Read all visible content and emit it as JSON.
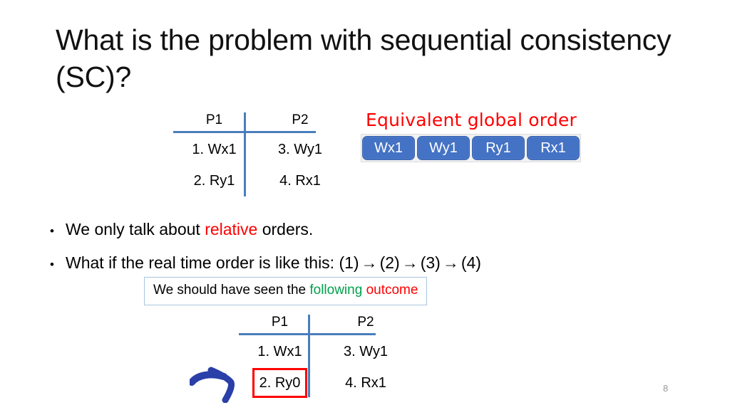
{
  "slide": {
    "title": "What is the problem with sequential consistency (SC)?",
    "page_number": "8"
  },
  "table_one": {
    "headers": {
      "p1": "P1",
      "p2": "P2"
    },
    "rows": [
      {
        "left": "1. Wx1",
        "right": "3. Wy1"
      },
      {
        "left": "2. Ry1",
        "right": "4. Rx1"
      }
    ]
  },
  "global_order": {
    "label": "Equivalent global order",
    "chips": [
      "Wx1",
      "Wy1",
      "Ry1",
      "Rx1"
    ],
    "chip_color": "#4472c4",
    "label_color": "#ff0000"
  },
  "bullets": [
    {
      "marker": "•",
      "part1": "We only talk about ",
      "emphasis": "relative",
      "emphasis_color": "#ff0000",
      "part2": " orders."
    },
    {
      "marker": "•",
      "text_before": "What if the real time order is like this: ",
      "seq": [
        "(1)",
        "(2)",
        "(3)",
        "(4)"
      ],
      "arrow": "→"
    }
  ],
  "callout": {
    "part1": "We should have seen the ",
    "word_green": "following",
    "space": " ",
    "word_red": "outcome",
    "green_color": "#00a14b",
    "red_color": "#ff0000",
    "border_color": "#a9c4de"
  },
  "table_two": {
    "headers": {
      "p1": "P1",
      "p2": "P2"
    },
    "rows": [
      {
        "left": "1. Wx1",
        "right": "3. Wy1",
        "highlight": false
      },
      {
        "left": "2. Ry0",
        "right": "4. Rx1",
        "highlight": true
      }
    ],
    "highlight_color": "#ff0000"
  },
  "annotation_arrow": {
    "name": "hand-drawn-arrow",
    "color": "#2b3fa8"
  }
}
